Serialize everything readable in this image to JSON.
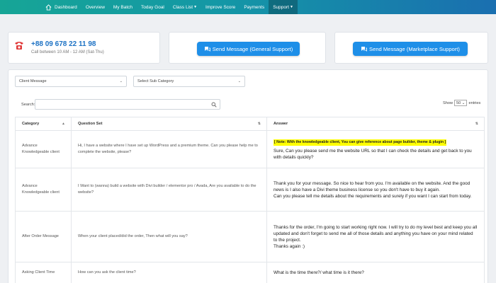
{
  "nav": {
    "items": [
      {
        "label": "Dashboard"
      },
      {
        "label": "Overview"
      },
      {
        "label": "My Batch"
      },
      {
        "label": "Today Goal"
      },
      {
        "label": "Class List"
      },
      {
        "label": "Improve Score"
      },
      {
        "label": "Payments"
      },
      {
        "label": "Support"
      }
    ],
    "active": "Support"
  },
  "contact": {
    "phone": "+88 09 678 22 11 98",
    "hours": "Call between 10 AM - 12 AM (Sat-Thu)"
  },
  "buttons": {
    "general_support": "Send Message (General Support)",
    "marketplace_support": "Send Message (Marketplace Support)"
  },
  "filters": {
    "category": "Client Message",
    "sub_category": "Select Sub Category"
  },
  "table_controls": {
    "search_label": "Search:",
    "show_label": "Show",
    "entries_value": "50",
    "entries_label": "entries"
  },
  "table": {
    "headers": [
      "Category",
      "Question Set",
      "Answer"
    ],
    "rows": [
      {
        "category": "Advance Knowledgeable client",
        "question": "Hi, I have a website where I have set up WordPress and a premium theme. Can you please help me to complete the website, please?",
        "note": "[ Note: With the knowledgeable client, You can give reference about page builder, theme & plugin ]",
        "answer": "Sure, Can you please send me the website URL so that I can check the details and get back to you with details quickly?"
      },
      {
        "category": "Advance Knowledgeable client",
        "question": "I Want to (wanna) build a website with Divi builder / elementor pro / Avada, Are you available to do the website?",
        "note": "",
        "answer": "Thank you for your message. So nice to hear from you. I'm available on the website. And the good news is I also have a Divi theme business license so you don't have to buy it again.\nCan you please tell me details about the requirements and surely if you want I can start from today."
      },
      {
        "category": "After Order Message",
        "question": "When your client placed/did the order, Then what will you say?",
        "note": "",
        "answer": "Thanks for the order, I'm going to start working right now. I will try to do my level best and keep you all updated and don't forget to send me all of those details and anything you have on your mind related to the project.\nThanks again :)"
      },
      {
        "category": "Asking Client Time",
        "question": "How can you ask the client time?",
        "note": "",
        "answer": "What is the time there?/ what time is it there?"
      }
    ]
  },
  "colors": {
    "nav_start": "#16a596",
    "nav_end": "#1a6fb0",
    "button": "#1e8fe8",
    "phone_text": "#1d72c4",
    "phone_icon": "#e03b3b",
    "highlight": "#ffff00"
  }
}
